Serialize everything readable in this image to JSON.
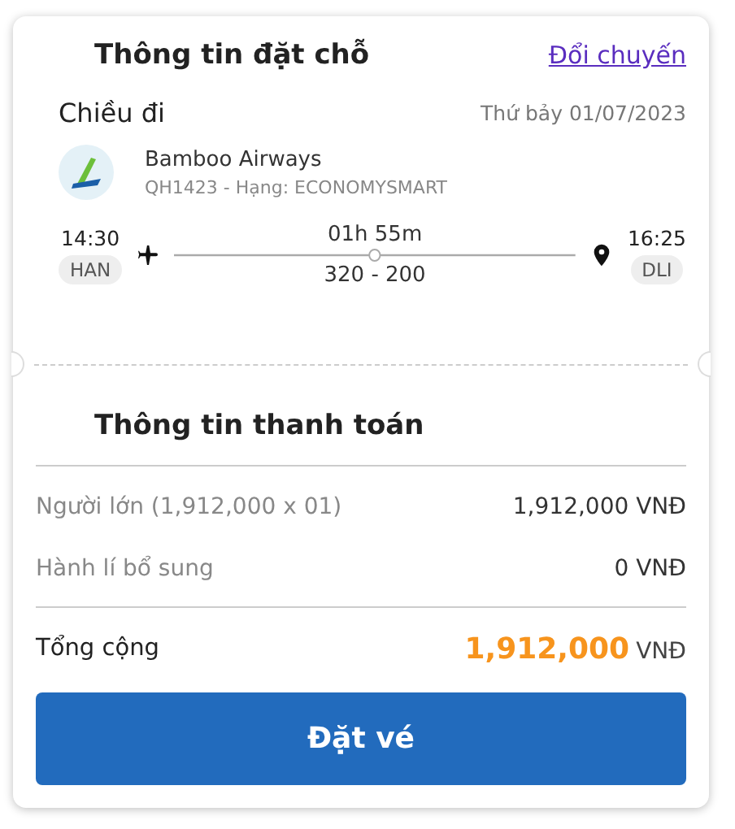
{
  "booking": {
    "title": "Thông tin đặt chỗ",
    "change_link": "Đổi chuyến"
  },
  "leg": {
    "label": "Chiều đi",
    "date": "Thứ bảy 01/07/2023",
    "airline": "Bamboo Airways",
    "flight": "QH1423 - Hạng: ECONOMYSMART",
    "depart_time": "14:30",
    "depart_code": "HAN",
    "duration": "01h 55m",
    "aircraft": "320 - 200",
    "arrive_time": "16:25",
    "arrive_code": "DLI"
  },
  "payment": {
    "title": "Thông tin thanh toán",
    "rows": [
      {
        "label": "Người lớn (1,912,000 x 01)",
        "value": "1,912,000 VNĐ"
      },
      {
        "label": "Hành lí bổ sung",
        "value": "0 VNĐ"
      }
    ],
    "total": {
      "label": "Tổng cộng",
      "amount": "1,912,000",
      "currency": "VNĐ"
    }
  },
  "buttons": [
    "Đặt vé"
  ]
}
